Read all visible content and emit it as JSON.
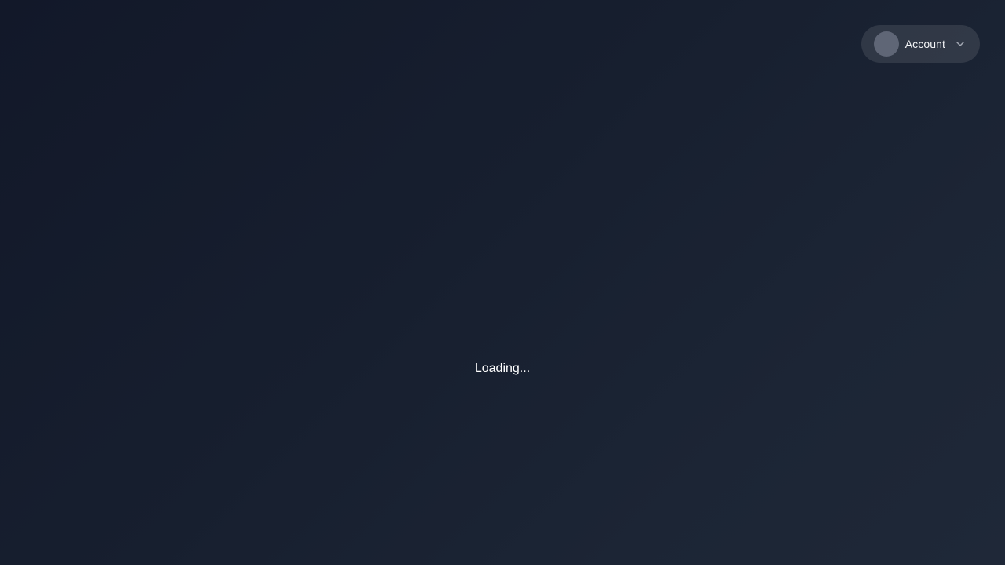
{
  "header": {
    "account_menu": {
      "label": "Account",
      "icon": "chevron-down-icon"
    }
  },
  "main": {
    "loading_text": "Loading..."
  },
  "colors": {
    "background_start": "#121829",
    "background_end": "#1f2838",
    "avatar": "#5f6676",
    "text": "#ffffff"
  }
}
